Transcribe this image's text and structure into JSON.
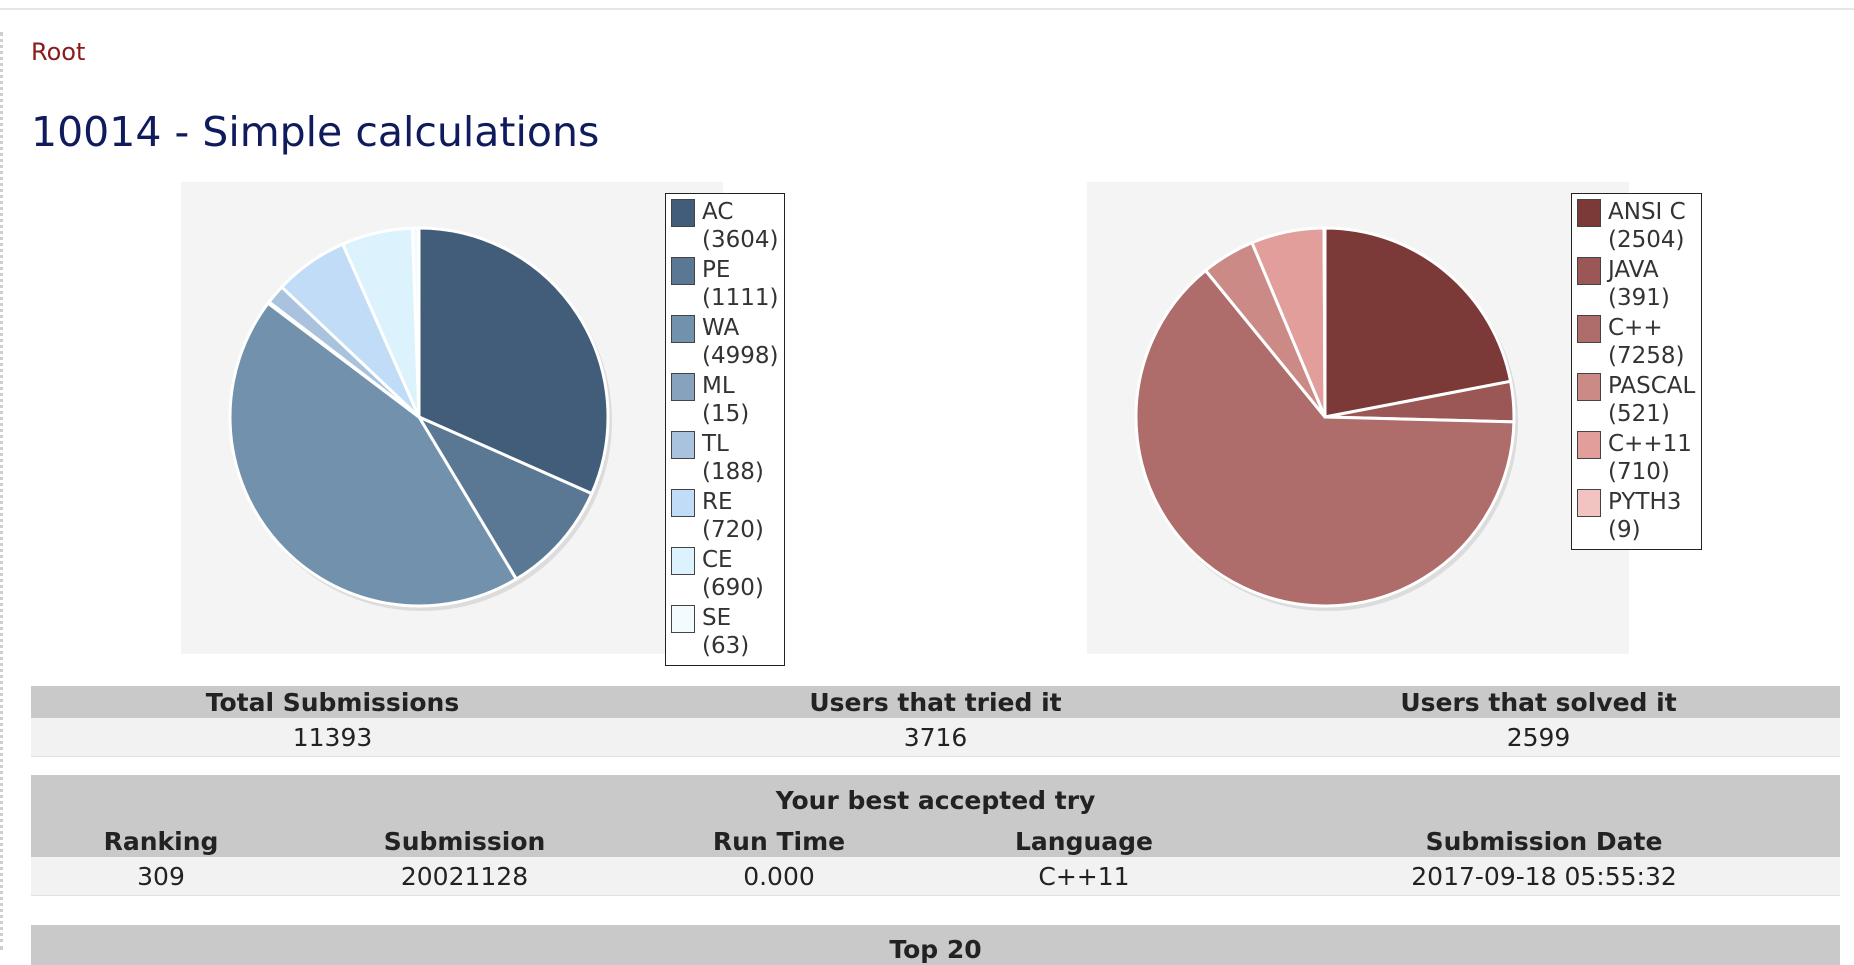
{
  "breadcrumb": "Root",
  "title": "10014 - Simple calculations",
  "chart_data": [
    {
      "type": "pie",
      "categories": [
        "AC",
        "PE",
        "WA",
        "ML",
        "TL",
        "RE",
        "CE",
        "SE"
      ],
      "values": [
        3604,
        1111,
        4998,
        15,
        188,
        720,
        690,
        63
      ],
      "legend": [
        "AC (3604)",
        "PE (1111)",
        "WA (4998)",
        "ML (15)",
        "TL (188)",
        "RE (720)",
        "CE (690)",
        "SE (63)"
      ],
      "colors": [
        "#425d7a",
        "#5a7894",
        "#7191ad",
        "#86a2bd",
        "#a9c3de",
        "#c1dcf7",
        "#dcf2fc",
        "#f3fbff"
      ],
      "legend_position": "top-right"
    },
    {
      "type": "pie",
      "categories": [
        "ANSI C",
        "JAVA",
        "C++",
        "PASCAL",
        "C++11",
        "PYTH3"
      ],
      "values": [
        2504,
        391,
        7258,
        521,
        710,
        9
      ],
      "legend": [
        "ANSI C (2504)",
        "JAVA (391)",
        "C++ (7258)",
        "PASCAL (521)",
        "C++11 (710)",
        "PYTH3 (9)"
      ],
      "colors": [
        "#7b3a38",
        "#9b5656",
        "#ae6d6a",
        "#cc8a86",
        "#e19e9b",
        "#f2c4c1"
      ],
      "legend_position": "top-right"
    }
  ],
  "stats": {
    "headers": [
      "Total Submissions",
      "Users that tried it",
      "Users that solved it"
    ],
    "values": [
      "11393",
      "3716",
      "2599"
    ]
  },
  "best": {
    "caption": "Your best accepted try",
    "headers": [
      "Ranking",
      "Submission",
      "Run Time",
      "Language",
      "Submission Date"
    ],
    "values": [
      "309",
      "20021128",
      "0.000",
      "C++11",
      "2017-09-18 05:55:32"
    ]
  },
  "top20": "Top 20"
}
